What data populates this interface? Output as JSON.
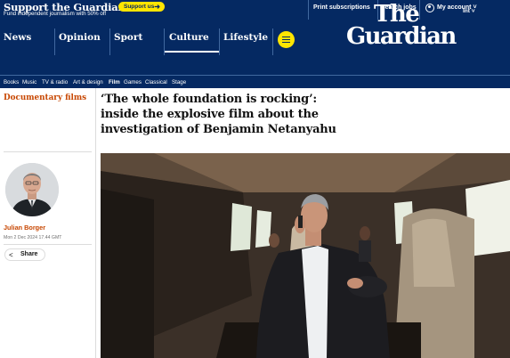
{
  "support": {
    "title": "Support the Guardian",
    "subtitle": "Fund independent journalism with 50% off",
    "button_label": "Support us",
    "button_arrow": "➜"
  },
  "top_links": {
    "print_subscriptions": "Print subscriptions",
    "search_jobs": "Search jobs",
    "my_account": "My account",
    "account_chevron": "˅"
  },
  "edition": {
    "label": "Int",
    "chevron": "˅"
  },
  "logo": {
    "line1": "The",
    "line2": "Guardian"
  },
  "nav": {
    "items": [
      {
        "label": "News"
      },
      {
        "label": "Opinion"
      },
      {
        "label": "Sport"
      },
      {
        "label": "Culture",
        "active": true
      },
      {
        "label": "Lifestyle"
      }
    ]
  },
  "subnav": {
    "items": [
      {
        "label": "Books"
      },
      {
        "label": "Music"
      },
      {
        "label": "TV & radio"
      },
      {
        "label": "Art & design"
      },
      {
        "label": "Film",
        "active": true
      },
      {
        "label": "Games"
      },
      {
        "label": "Classical"
      },
      {
        "label": "Stage"
      }
    ]
  },
  "article": {
    "section": "Documentary films",
    "headline_lines": [
      "‘The whole foundation is rocking’:",
      "inside the explosive film about the",
      "investigation of Benjamin Netanyahu"
    ],
    "author": "Julian Borger",
    "date": "Mon 2 Dec 2024 17.44 GMT",
    "share_label": "Share",
    "share_icon": "share-icon"
  },
  "colors": {
    "brand_blue": "#052962",
    "accent_yellow": "#ffe500",
    "culture_orange": "#c74600"
  }
}
